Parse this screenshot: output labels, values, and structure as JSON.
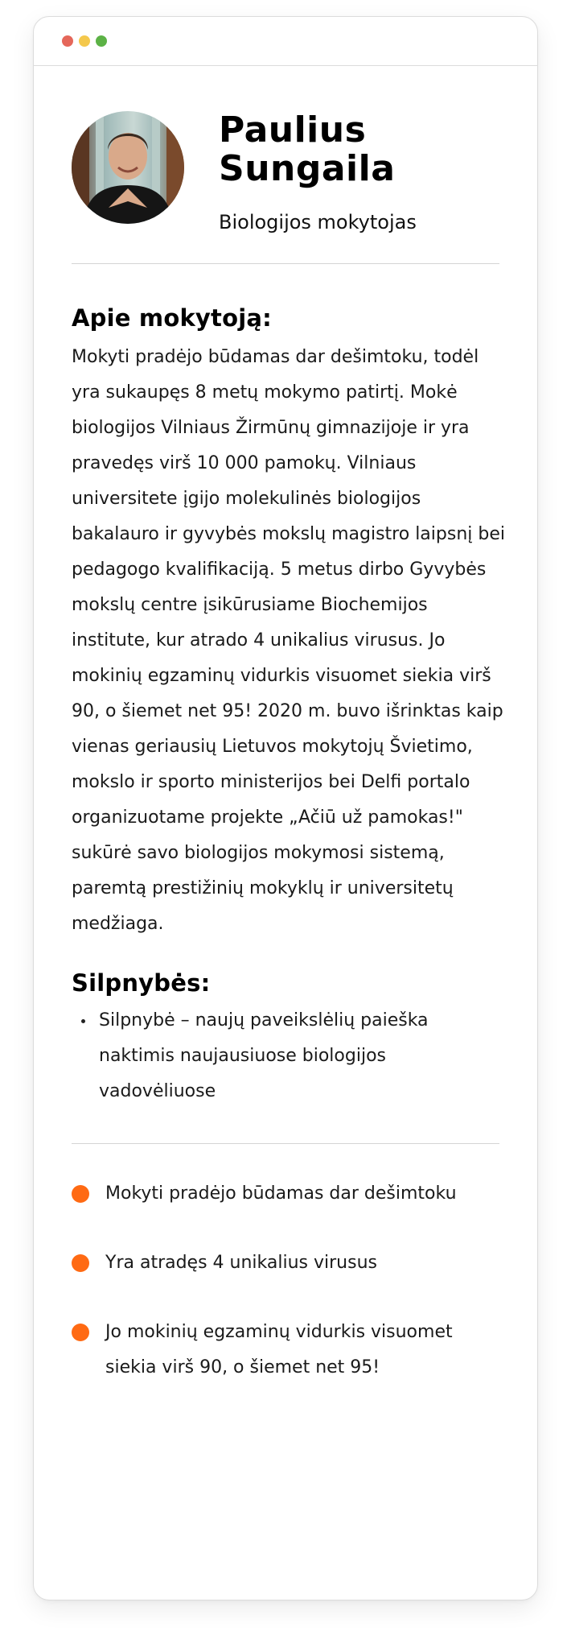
{
  "window": {
    "controls": {
      "close_color": "#e5675a",
      "minimize_color": "#f4c84c",
      "maximize_color": "#5cb246"
    }
  },
  "profile": {
    "name": "Paulius Sungaila",
    "role": "Biologijos mokytojas",
    "avatar_icon": "teacher-portrait-photo"
  },
  "about": {
    "heading": "Apie mokytoją:",
    "text": "Mokyti pradėjo būdamas dar dešimtoku, todėl yra sukaupęs 8 metų mokymo patirtį. Mokė biologijos Vilniaus Žirmūnų gimnazijoje ir yra pravedęs virš 10 000 pamokų. Vilniaus universitete įgijo molekulinės biologijos bakalauro ir gyvybės mokslų magistro laipsnį bei pedagogo kvalifikaciją. 5 metus dirbo Gyvybės mokslų centre įsikūrusiame Biochemijos institute, kur atrado 4 unikalius virusus. Jo mokinių egzaminų vidurkis visuomet siekia virš 90, o šiemet net 95! 2020 m. buvo išrinktas kaip vienas geriausių Lietuvos mokytojų Švietimo, mokslo ir sporto ministerijos bei Delfi portalo organizuotame projekte „Ačiū už pamokas!\" sukūrė savo biologijos mokymosi sistemą, paremtą prestižinių mokyklų ir universitetų medžiaga."
  },
  "weaknesses": {
    "heading": "Silpnybės:",
    "items": [
      "Silpnybė – naujų paveikslėlių paieška naktimis naujausiuose biologijos vadovėliuose"
    ]
  },
  "highlights": {
    "accent_color": "#ff6a13",
    "items": [
      "Mokyti pradėjo būdamas dar dešimtoku",
      "Yra atradęs 4 unikalius virusus",
      "Jo mokinių egzaminų vidurkis visuomet siekia virš 90, o šiemet net 95!"
    ]
  }
}
